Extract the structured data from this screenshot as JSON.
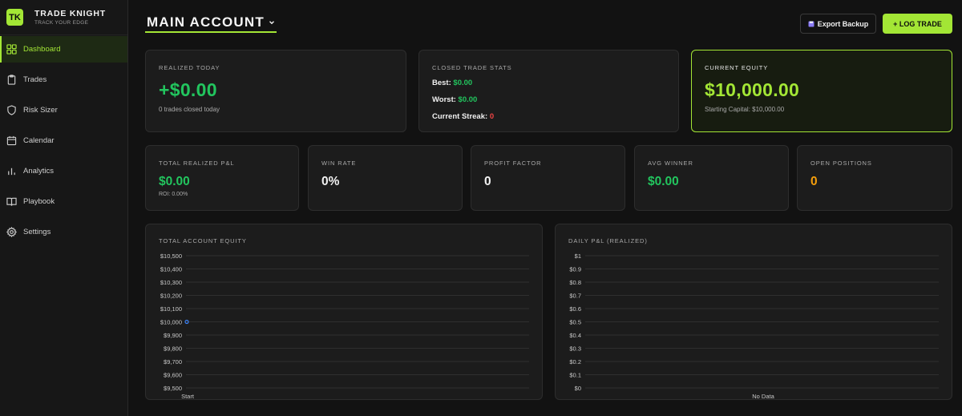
{
  "brand": {
    "logo": "TK",
    "name": "TRADE KNIGHT",
    "tagline": "TRACK YOUR EDGE"
  },
  "nav": [
    {
      "label": "Dashboard",
      "icon": "dashboard-icon",
      "active": true
    },
    {
      "label": "Trades",
      "icon": "clipboard-icon",
      "active": false
    },
    {
      "label": "Risk Sizer",
      "icon": "shield-icon",
      "active": false
    },
    {
      "label": "Calendar",
      "icon": "calendar-icon",
      "active": false
    },
    {
      "label": "Analytics",
      "icon": "bar-chart-icon",
      "active": false
    },
    {
      "label": "Playbook",
      "icon": "book-icon",
      "active": false
    },
    {
      "label": "Settings",
      "icon": "gear-icon",
      "active": false
    }
  ],
  "header": {
    "account": "MAIN ACCOUNT",
    "export_label": "Export Backup",
    "log_label": "+ LOG TRADE"
  },
  "colors": {
    "accent": "#a3e635",
    "positive": "#22c55e",
    "negative": "#ef4444",
    "warning": "#f59e0b",
    "chart_line": "#3b82f6"
  },
  "realized_today": {
    "label": "REALIZED TODAY",
    "value": "+$0.00",
    "note": "0 trades closed today"
  },
  "closed_stats": {
    "label": "CLOSED TRADE STATS",
    "best_label": "Best:",
    "best_value": "$0.00",
    "worst_label": "Worst:",
    "worst_value": "$0.00",
    "streak_label": "Current Streak:",
    "streak_value": "0"
  },
  "current_equity": {
    "label": "CURRENT EQUITY",
    "value": "$10,000.00",
    "note": "Starting Capital: $10,000.00"
  },
  "metrics": {
    "total_pnl": {
      "label": "TOTAL REALIZED P&L",
      "value": "$0.00",
      "sub": "ROI: 0.00%"
    },
    "win_rate": {
      "label": "WIN RATE",
      "value": "0%"
    },
    "profit_factor": {
      "label": "PROFIT FACTOR",
      "value": "0"
    },
    "avg_winner": {
      "label": "AVG WINNER",
      "value": "$0.00"
    },
    "open_positions": {
      "label": "OPEN POSITIONS",
      "value": "0"
    }
  },
  "charts": {
    "equity": {
      "label": "TOTAL ACCOUNT EQUITY",
      "ticks": [
        "$10,500",
        "$10,400",
        "$10,300",
        "$10,200",
        "$10,100",
        "$10,000",
        "$9,900",
        "$9,800",
        "$9,700",
        "$9,600",
        "$9,500"
      ],
      "x_label": "Start"
    },
    "daily": {
      "label": "DAILY P&L (REALIZED)",
      "ticks": [
        "$1",
        "$0.9",
        "$0.8",
        "$0.7",
        "$0.6",
        "$0.5",
        "$0.4",
        "$0.3",
        "$0.2",
        "$0.1",
        "$0"
      ],
      "x_label": "No Data"
    }
  },
  "chart_data": [
    {
      "type": "line",
      "title": "TOTAL ACCOUNT EQUITY",
      "x": [
        "Start"
      ],
      "series": [
        {
          "values": [
            10000
          ]
        }
      ],
      "ylim": [
        9500,
        10500
      ],
      "grid": true
    },
    {
      "type": "bar",
      "title": "DAILY P&L (REALIZED)",
      "categories": [],
      "values": [],
      "ylim": [
        0,
        1
      ],
      "grid": true
    }
  ]
}
